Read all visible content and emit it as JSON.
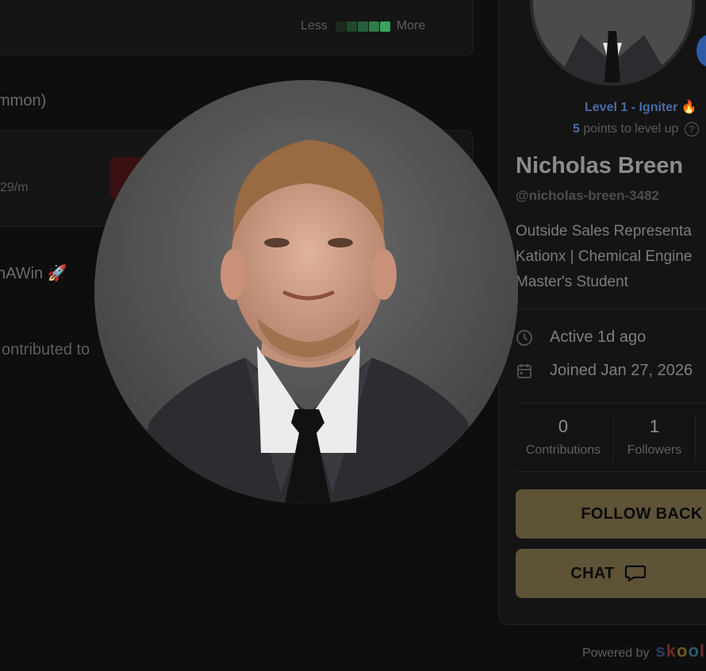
{
  "activity": {
    "legend_less": "Less",
    "legend_more": "More",
    "legend_colors": [
      "#1c2a1f",
      "#1f4a2a",
      "#26613a",
      "#2f7d48",
      "#3ea35a"
    ]
  },
  "left": {
    "section_partial": "mmon)",
    "price_partial": "29/m",
    "post_partial": "nAWin 🚀",
    "contrib_partial": "ontributed to"
  },
  "profile": {
    "level_label": "Level 1 - Igniter 🔥",
    "points_number": "5",
    "points_text": "points to level up",
    "help_icon_glyph": "?",
    "name": "Nicholas Breen",
    "handle": "@nicholas-breen-3482",
    "bio_lines": [
      "Outside Sales Representa",
      "Kationx | Chemical Engine",
      "Master's Student"
    ],
    "active": "Active 1d ago",
    "joined": "Joined Jan 27, 2026",
    "stats": [
      {
        "value": "0",
        "label": "Contributions"
      },
      {
        "value": "1",
        "label": "Followers"
      }
    ],
    "follow_back": "FOLLOW BACK",
    "chat": "CHAT",
    "level_color": "#4a6ba8"
  },
  "footer": {
    "powered_by": "Powered by",
    "brand": "skool"
  },
  "icons": [
    "clock-icon",
    "calendar-icon",
    "chat-bubble-icon",
    "rocket-icon",
    "fire-icon",
    "help-icon"
  ]
}
